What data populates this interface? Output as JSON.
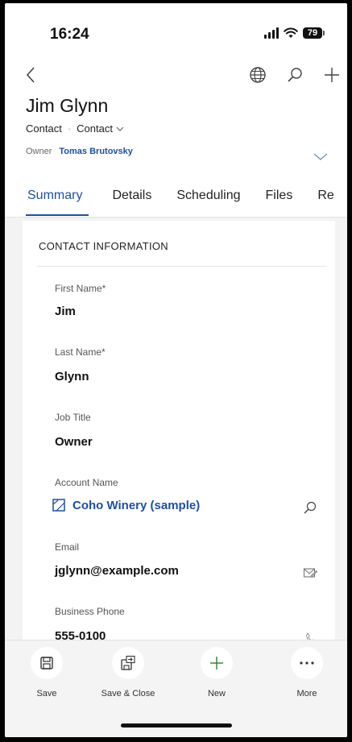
{
  "status_bar": {
    "time": "16:24",
    "battery": "79"
  },
  "header": {
    "title": "Jim Glynn",
    "entity": "Contact",
    "form": "Contact",
    "owner_label": "Owner",
    "owner_name": "Tomas Brutovsky"
  },
  "tabs": [
    "Summary",
    "Details",
    "Scheduling",
    "Files",
    "Re"
  ],
  "section": {
    "title": "CONTACT INFORMATION"
  },
  "fields": {
    "first_name": {
      "label": "First Name*",
      "value": "Jim"
    },
    "last_name": {
      "label": "Last Name*",
      "value": "Glynn"
    },
    "job_title": {
      "label": "Job Title",
      "value": "Owner"
    },
    "account_name": {
      "label": "Account Name",
      "value": "Coho Winery (sample)"
    },
    "email": {
      "label": "Email",
      "value": "jglynn@example.com"
    },
    "business_phone": {
      "label": "Business Phone",
      "value": "555-0100"
    }
  },
  "command_bar": {
    "save": "Save",
    "save_close": "Save & Close",
    "new": "New",
    "more": "More"
  },
  "colors": {
    "accent": "#1e50a0",
    "background": "#f3f3f3"
  },
  "icons": [
    "back-icon",
    "globe-icon",
    "search-icon",
    "add-icon",
    "chevron-down-icon",
    "account-icon",
    "email-compose-icon",
    "save-icon",
    "save-close-icon",
    "more-icon"
  ]
}
